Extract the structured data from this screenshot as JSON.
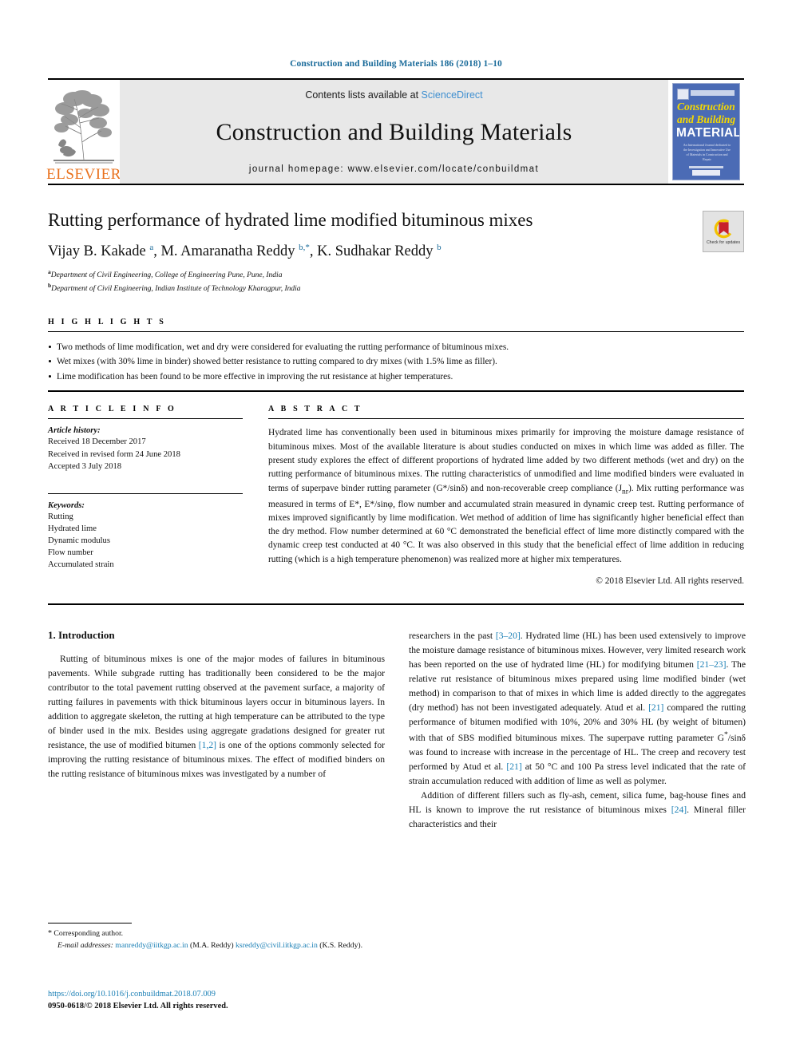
{
  "running_head": "Construction and Building Materials 186 (2018) 1–10",
  "masthead": {
    "contents_prefix": "Contents lists available at ",
    "sciencedirect": "ScienceDirect",
    "journal_name": "Construction and Building Materials",
    "homepage": "journal homepage: www.elsevier.com/locate/conbuildmat",
    "publisher_logo_text": "ELSEVIER",
    "cover": {
      "line1": "Construction",
      "line2": "and Building",
      "line3": "MATERIALS",
      "blurb": "An International Journal dedicated to the Investigation and Innovative Use of Materials in Construction and Repair"
    },
    "accent_link_color": "#3f8fd0",
    "elsevier_orange": "#E9711C",
    "cover_blue": "#4b6bb5"
  },
  "article": {
    "title": "Rutting performance of hydrated lime modified bituminous mixes",
    "authors_html": "Vijay B. Kakade <sup>a</sup>, M. Amaranatha Reddy <sup>b,*</sup>, K. Sudhakar Reddy <sup>b</sup>",
    "affiliation_a": "Department of Civil Engineering, College of Engineering Pune, Pune, India",
    "affiliation_b": "Department of Civil Engineering, Indian Institute of Technology Kharagpur, India",
    "crossmark_label": "Check for updates"
  },
  "highlights": {
    "label": "H I G H L I G H T S",
    "items": [
      "Two methods of lime modification, wet and dry were considered for evaluating the rutting performance of bituminous mixes.",
      "Wet mixes (with 30% lime in binder) showed better resistance to rutting compared to dry mixes (with 1.5% lime as filler).",
      "Lime modification has been found to be more effective in improving the rut resistance at higher temperatures."
    ]
  },
  "article_info": {
    "label": "A R T I C L E   I N F O",
    "history_head": "Article history:",
    "history": [
      "Received 18 December 2017",
      "Received in revised form 24 June 2018",
      "Accepted 3 July 2018"
    ],
    "keywords_head": "Keywords:",
    "keywords": [
      "Rutting",
      "Hydrated lime",
      "Dynamic modulus",
      "Flow number",
      "Accumulated strain"
    ]
  },
  "abstract": {
    "label": "A B S T R A C T",
    "text_html": "Hydrated lime has conventionally been used in bituminous mixes primarily for improving the moisture damage resistance of bituminous mixes. Most of the available literature is about studies conducted on mixes in which lime was added as filler. The present study explores the effect of different proportions of hydrated lime added by two different methods (wet and dry) on the rutting performance of bituminous mixes. The rutting characteristics of unmodified and lime modified binders were evaluated in terms of superpave binder rutting parameter (G*/sin&delta;) and non-recoverable creep compliance (J<sub>nr</sub>). Mix rutting performance was measured in terms of E*, E*/sin&phi;, flow number and accumulated strain measured in dynamic creep test. Rutting performance of mixes improved significantly by lime modification. Wet method of addition of lime has significantly higher beneficial effect than the dry method. Flow number determined at 60&nbsp;&deg;C demonstrated the beneficial effect of lime more distinctly compared with the dynamic creep test conducted at 40&nbsp;&deg;C. It was also observed in this study that the beneficial effect of lime addition in reducing rutting (which is a high temperature phenomenon) was realized more at higher mix temperatures.",
    "copyright": "© 2018 Elsevier Ltd. All rights reserved."
  },
  "body": {
    "section_heading": "1. Introduction",
    "left_paragraph_html": "Rutting of bituminous mixes is one of the major modes of failures in bituminous pavements. While subgrade rutting has traditionally been considered to be the major contributor to the total pavement rutting observed at the pavement surface, a majority of rutting failures in pavements with thick bituminous layers occur in bituminous layers. In addition to aggregate skeleton, the rutting at high temperature can be attributed to the type of binder used in the mix. Besides using aggregate gradations designed for greater rut resistance, the use of modified bitumen <span class=\"ref\">[1,2]</span> is one of the options commonly selected for improving the rutting resistance of bituminous mixes. The effect of modified binders on the rutting resistance of bituminous mixes was investigated by a number of",
    "right_paragraph_1_html": "researchers in the past <span class=\"ref\">[3–20]</span>. Hydrated lime (HL) has been used extensively to improve the moisture damage resistance of bituminous mixes. However, very limited research work has been reported on the use of hydrated lime (HL) for modifying bitumen <span class=\"ref\">[21–23]</span>. The relative rut resistance of bituminous mixes prepared using lime modified binder (wet method) in comparison to that of mixes in which lime is added directly to the aggregates (dry method) has not been investigated adequately. Atud et al. <span class=\"ref\">[21]</span> compared the rutting performance of bitumen modified with 10%, 20% and 30% HL (by weight of bitumen) with that of SBS modified bituminous mixes. The superpave rutting parameter G<sup>*</sup>/sin&delta; was found to increase with increase in the percentage of HL. The creep and recovery test performed by Atud et al. <span class=\"ref\">[21]</span> at 50&nbsp;&deg;C and 100&nbsp;Pa stress level indicated that the rate of strain accumulation reduced with addition of lime as well as polymer.",
    "right_paragraph_2_html": "Addition of different fillers such as fly-ash, cement, silica fume, bag-house fines and HL is known to improve the rut resistance of bituminous mixes <span class=\"ref\">[24]</span>. Mineral filler characteristics and their"
  },
  "footnotes": {
    "corresponding": "Corresponding author.",
    "email_label": "E-mail addresses:",
    "email_1": "manreddy@iitkgp.ac.in",
    "email_1_owner": "(M.A. Reddy)",
    "email_2": "ksreddy@civil.iitkgp.ac.in",
    "email_2_owner": "(K.S. Reddy).",
    "doi": "https://doi.org/10.1016/j.conbuildmat.2018.07.009",
    "issn": "0950-0618/© 2018 Elsevier Ltd. All rights reserved.",
    "link_color": "#1a7fb5"
  }
}
